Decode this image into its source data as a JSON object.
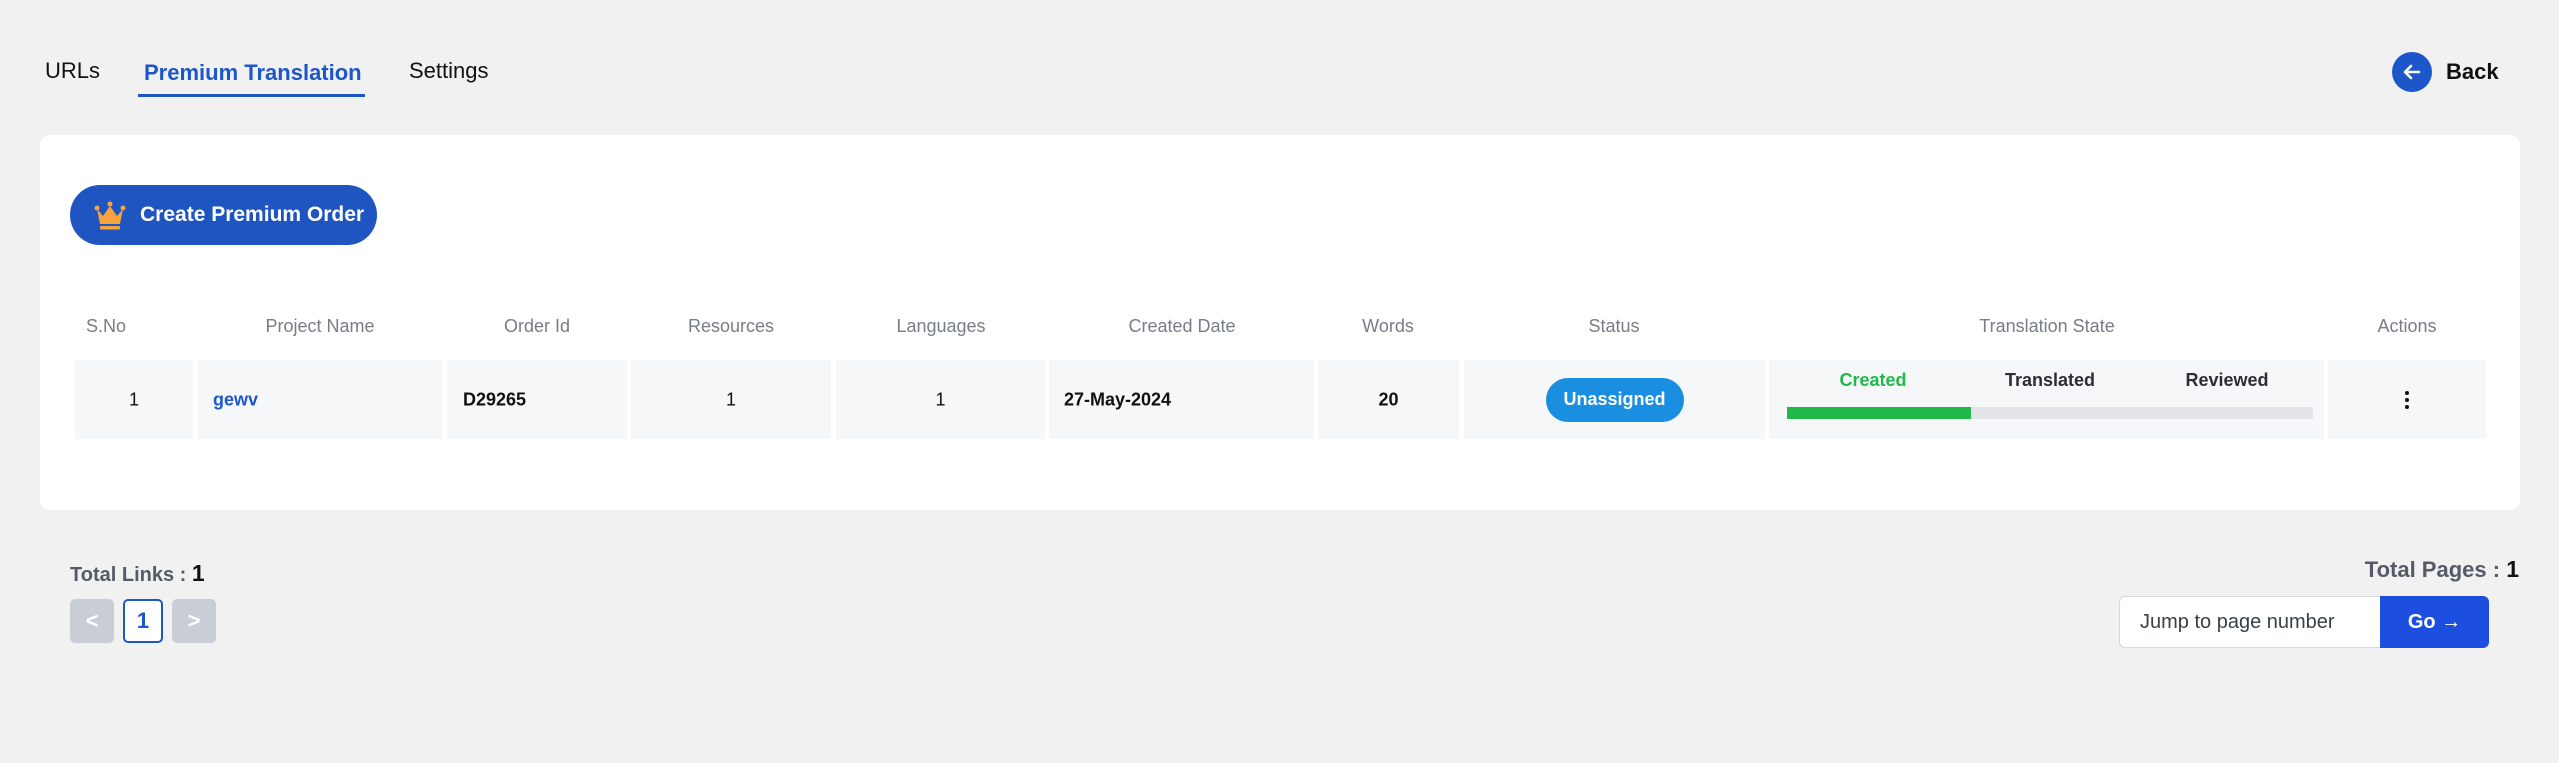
{
  "tabs": {
    "urls": "URLs",
    "premium_translation": "Premium Translation",
    "settings": "Settings"
  },
  "back_label": "Back",
  "create_button_label": "Create Premium Order",
  "table": {
    "headers": [
      "S.No",
      "Project Name",
      "Order Id",
      "Resources",
      "Languages",
      "Created Date",
      "Words",
      "Status",
      "Translation State",
      "Actions"
    ],
    "rows": [
      {
        "sno": "1",
        "project_name": "gewv",
        "order_id": "D29265",
        "resources": "1",
        "languages": "1",
        "created_date": "27-May-2024",
        "words": "20",
        "status": "Unassigned",
        "translation_state": {
          "stages": [
            "Created",
            "Translated",
            "Reviewed"
          ],
          "current_stage": "Created",
          "progress_fraction": 0.35
        }
      }
    ]
  },
  "footer": {
    "total_links_label": "Total Links :",
    "total_links_value": "1",
    "total_pages_label": "Total Pages :",
    "total_pages_value": "1",
    "prev_label": "<",
    "current_page": "1",
    "next_label": ">",
    "jump_placeholder": "Jump to page number",
    "go_label": "Go →"
  },
  "colors": {
    "accent": "#1d56c9",
    "status_badge": "#1a8ee0",
    "progress_fill": "#21b84a",
    "created_stage_text": "#21b84a",
    "go_button": "#1c4fe0"
  }
}
